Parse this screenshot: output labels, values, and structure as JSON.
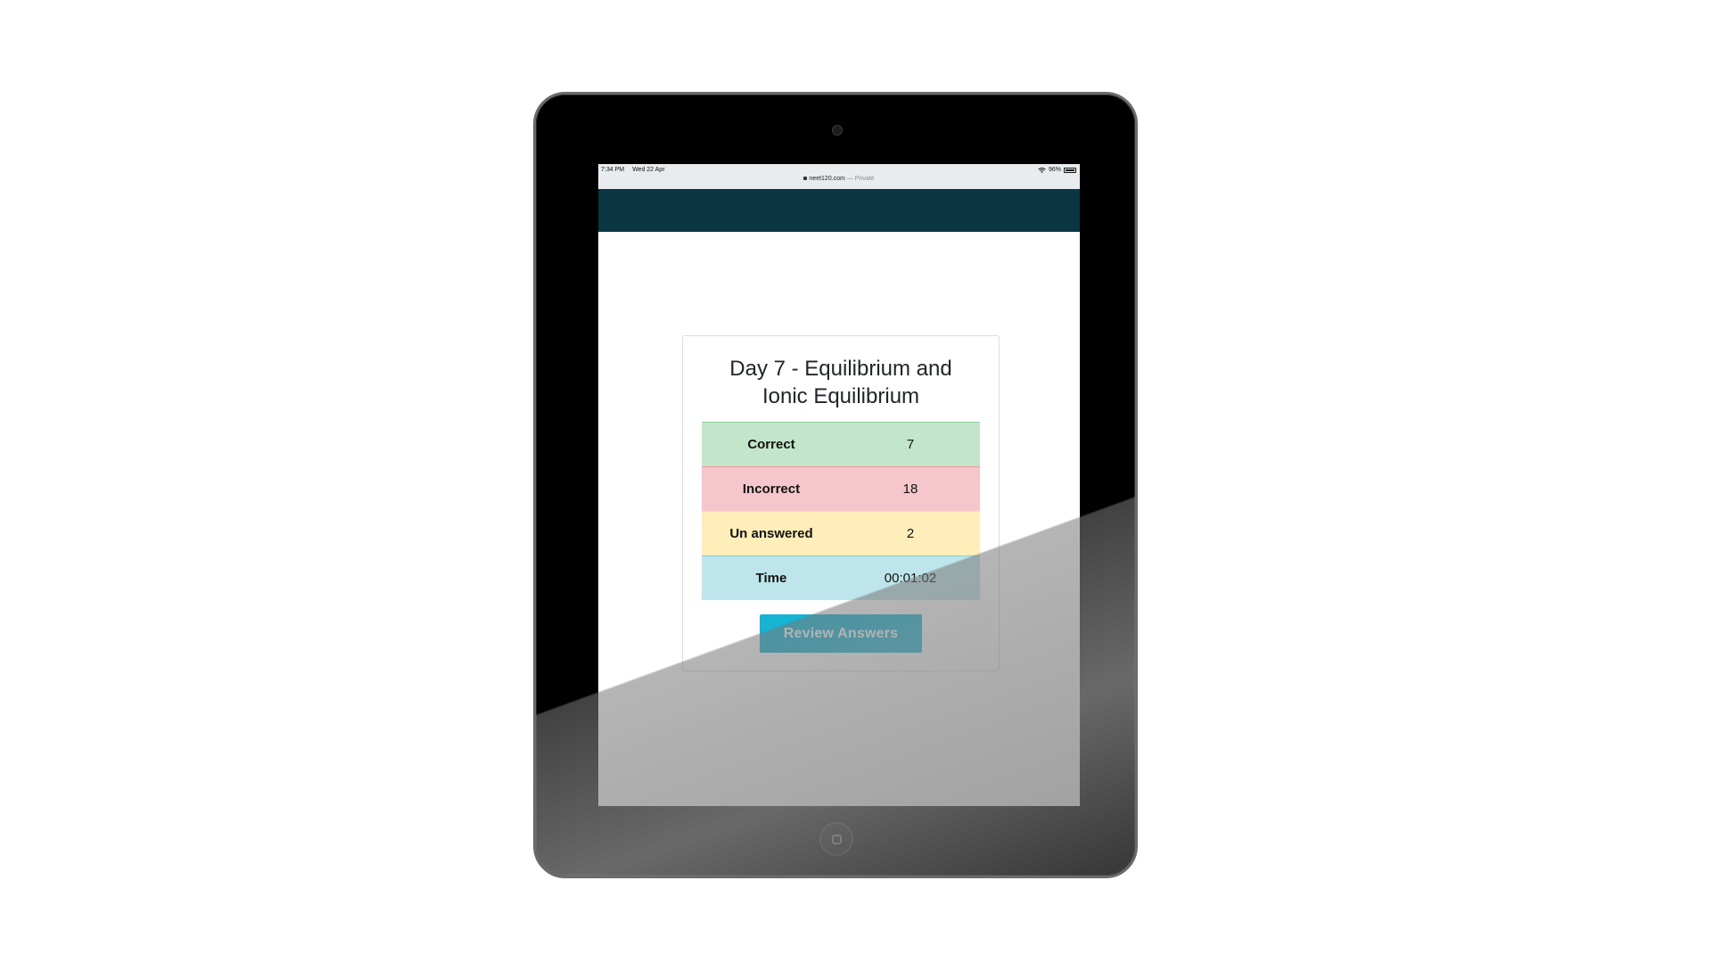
{
  "status_bar": {
    "time": "7:34 PM",
    "date": "Wed 22 Apr",
    "battery": "96%",
    "battery_level": 0.96
  },
  "browser": {
    "url": "neet120.com",
    "mode": "— Private"
  },
  "result": {
    "title": "Day 7 - Equilibrium and Ionic Equilibrium",
    "rows": [
      {
        "label": "Correct",
        "value": "7"
      },
      {
        "label": "Incorrect",
        "value": "18"
      },
      {
        "label": "Un answered",
        "value": "2"
      },
      {
        "label": "Time",
        "value": "00:01:02"
      }
    ],
    "colors": {
      "correct": "#c3e6cb",
      "incorrect": "#f5c6cb",
      "unanswered": "#ffeeba",
      "time": "#bee5eb",
      "button": "#17b3d3",
      "header": "#093642"
    },
    "review_button_label": "Review Answers"
  },
  "icons": {
    "wifi": "wifi-icon",
    "battery": "battery-icon",
    "lock": "lock-icon",
    "camera": "camera-icon",
    "home": "home-button-icon"
  }
}
